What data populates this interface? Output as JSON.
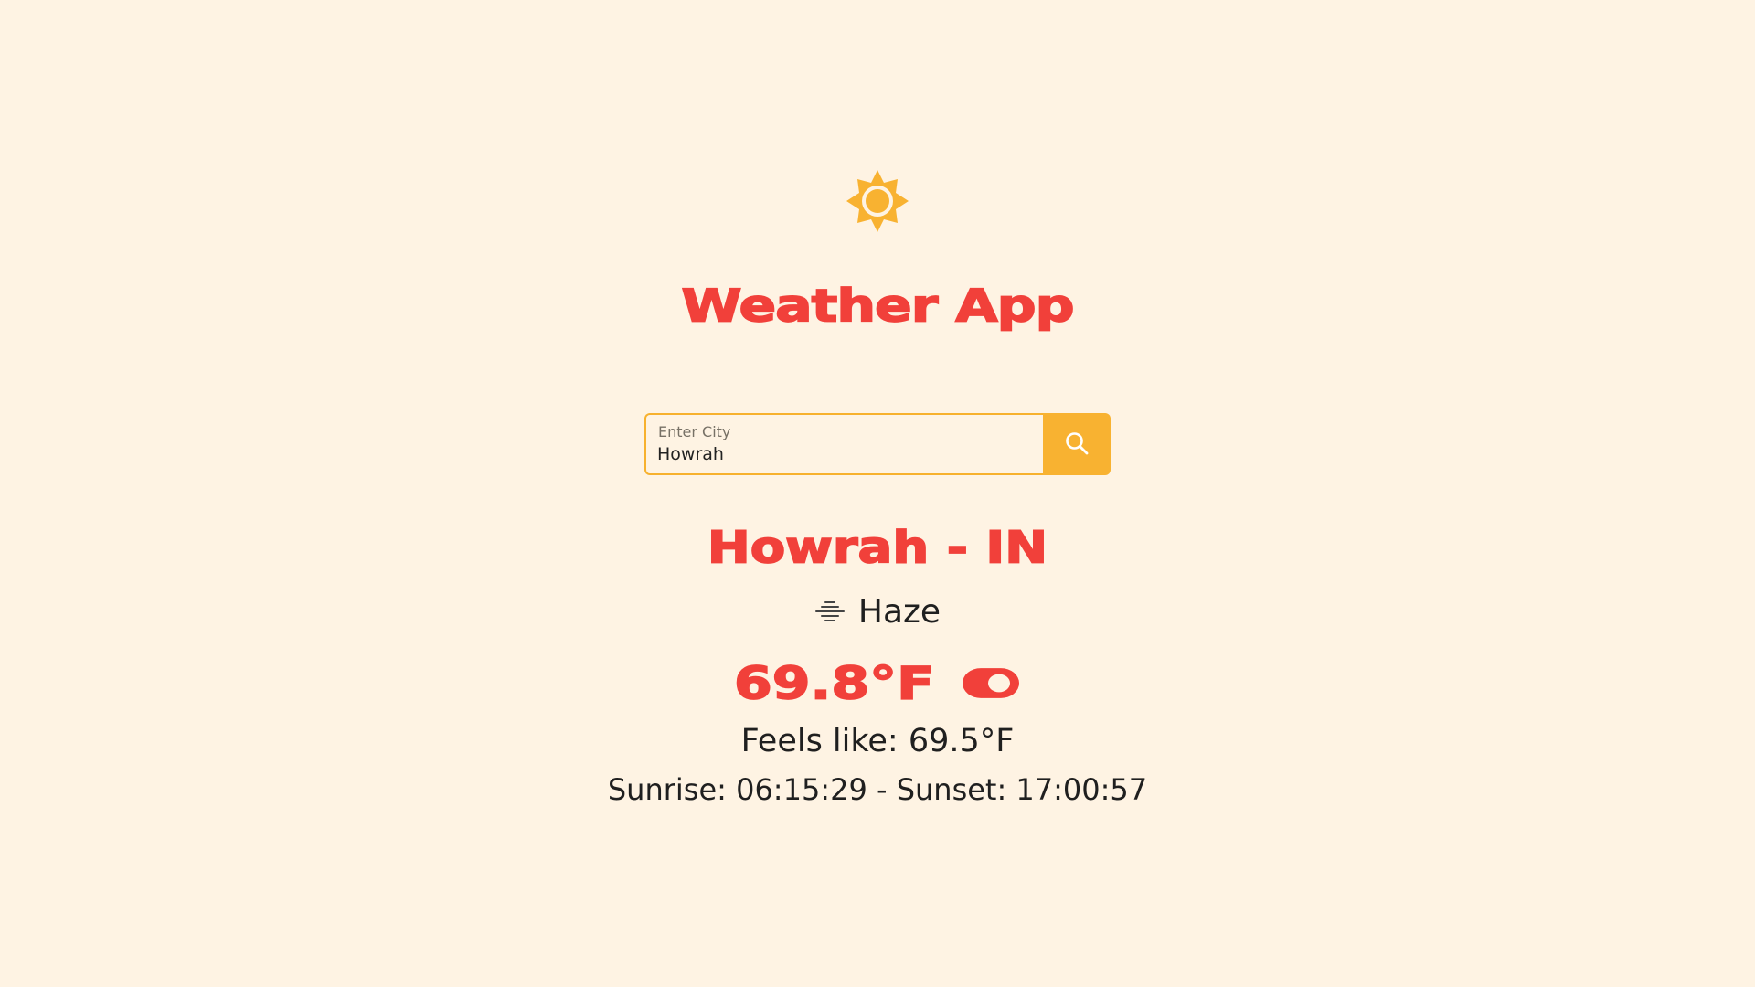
{
  "app": {
    "title": "Weather App",
    "logo_icon": "sun-icon"
  },
  "search": {
    "label": "Enter City",
    "value": "Howrah",
    "button_icon": "search-icon"
  },
  "weather": {
    "location": "Howrah - IN",
    "condition": "Haze",
    "condition_icon": "haze-icon",
    "temperature": "69.8°F",
    "unit_toggle_icon": "toggle-icon",
    "feels_like": "Feels like: 69.5°F",
    "sun_times": "Sunrise: 06:15:29 - Sunset: 17:00:57"
  },
  "colors": {
    "background": "#fef3e3",
    "accent_red": "#f1403a",
    "accent_yellow": "#f8b231",
    "text": "#1f1f1f"
  }
}
